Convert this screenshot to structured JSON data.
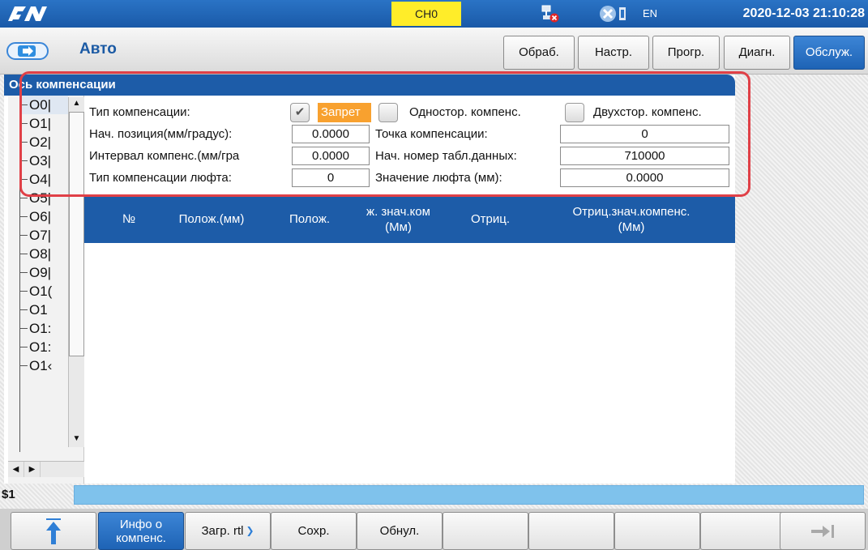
{
  "status": {
    "channel": "CH0",
    "lang": "EN",
    "datetime": "2020-12-03 21:10:28"
  },
  "mode": {
    "title": "Авто"
  },
  "tabs": [
    "Обраб.",
    "Настр.",
    "Прогр.",
    "Диагн.",
    "Обслуж."
  ],
  "panel": {
    "title": "Ось компенсации"
  },
  "tree": {
    "items": [
      "O0|",
      "O1|",
      "O2|",
      "O3|",
      "O4|",
      "O5|",
      "O6|",
      "O7|",
      "O8|",
      "O9|",
      "O1(",
      "O1",
      "O1:",
      "O1:",
      "O1‹"
    ]
  },
  "form": {
    "comp_type_label": "Тип компенсации:",
    "opt_disable": "Запрет",
    "opt_one_side": "Одностор. компенс.",
    "opt_two_side": "Двухстор. компенс.",
    "start_pos_label": "Нач. позиция(мм/градус):",
    "start_pos_value": "0.0000",
    "comp_point_label": "Точка компенсации:",
    "comp_point_value": "0",
    "interval_label": "Интервал компенс.(мм/гра",
    "interval_value": "0.0000",
    "table_start_label": "Нач. номер табл.данных:",
    "table_start_value": "710000",
    "backlash_type_label": "Тип компенсации люфта:",
    "backlash_type_value": "0",
    "backlash_value_label": "Значение люфта (мм):",
    "backlash_value": "0.0000"
  },
  "table": {
    "headers": [
      "№",
      "Полож.(мм)",
      "Полож.",
      "ж. знач.ком\n(Мм)",
      "Отриц.",
      "Отриц.знач.компенс.\n(Мм)"
    ]
  },
  "command": {
    "label": "$1"
  },
  "softkeys": {
    "info": "Инфо о компенс.",
    "load": "Загр. rtl",
    "save": "Сохр.",
    "reset": "Обнул."
  },
  "colors": {
    "header_blue": "#1d5ca8",
    "channel_yellow": "#ffed29",
    "selected_orange": "#f8a12f",
    "highlight_red": "#e04047",
    "command_bar": "#7fc2ec"
  }
}
